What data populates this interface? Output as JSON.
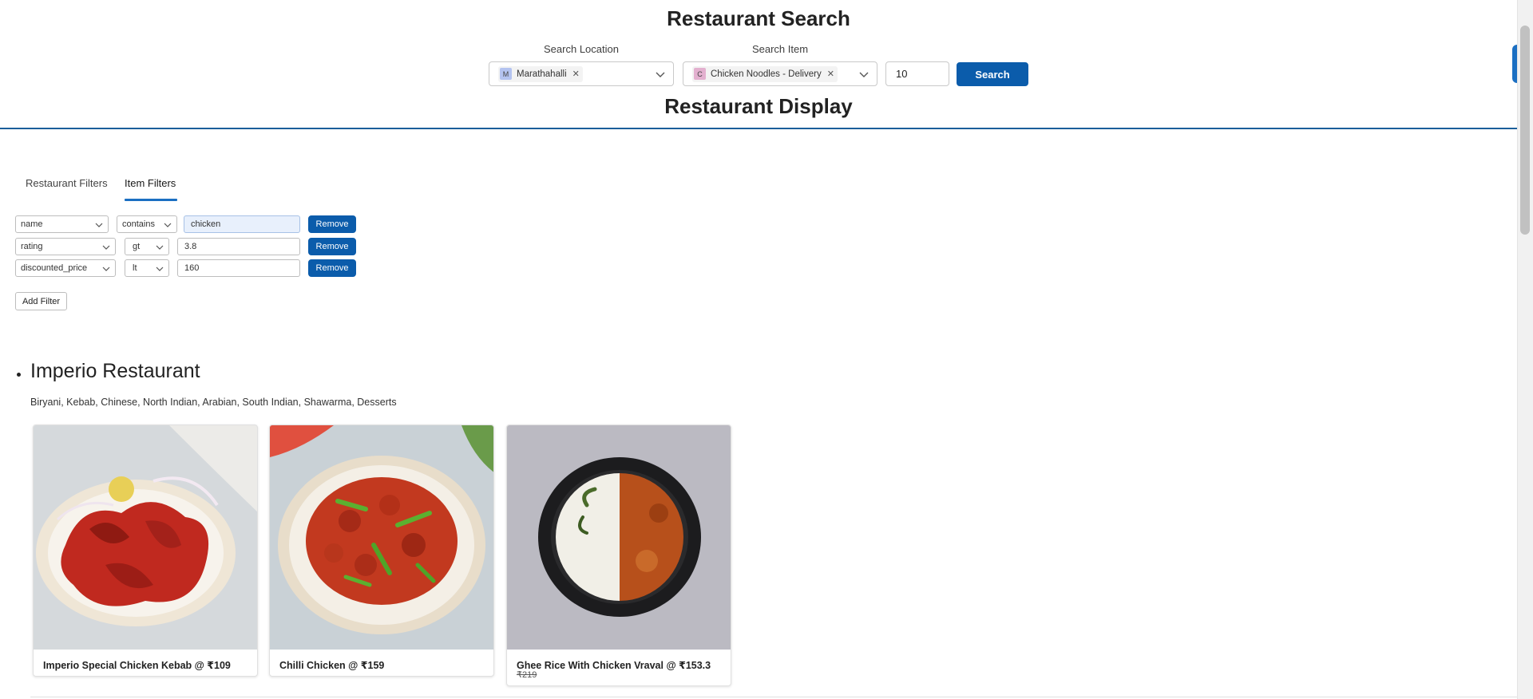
{
  "header": {
    "title": "Restaurant Search",
    "location_label": "Search Location",
    "item_label": "Search Item",
    "location_pill": {
      "avatar": "M",
      "text": "Marathahalli"
    },
    "item_pill": {
      "avatar": "C",
      "text": "Chicken Noodles - Delivery"
    },
    "count_value": "10",
    "search_button": "Search"
  },
  "display": {
    "title": "Restaurant Display"
  },
  "tabs": [
    {
      "label": "Restaurant Filters",
      "active": false
    },
    {
      "label": "Item Filters",
      "active": true
    }
  ],
  "filters": [
    {
      "field": "name",
      "op": "contains",
      "value": "chicken",
      "remove": "Remove"
    },
    {
      "field": "rating",
      "op": "gt",
      "value": "3.8",
      "remove": "Remove"
    },
    {
      "field": "discounted_price",
      "op": "lt",
      "value": "160",
      "remove": "Remove"
    }
  ],
  "add_filter_label": "Add Filter",
  "restaurant": {
    "name": "Imperio Restaurant",
    "cuisines": "Biryani, Kebab, Chinese, North Indian, Arabian, South Indian, Shawarma, Desserts",
    "items": [
      {
        "label": "Imperio Special Chicken Kebab @ ₹109",
        "original_price": ""
      },
      {
        "label": "Chilli Chicken @ ₹159",
        "original_price": ""
      },
      {
        "label": "Ghee Rice With Chicken Vraval @ ₹153.3",
        "original_price": "₹219"
      }
    ]
  },
  "colors": {
    "primary": "#0b5cab",
    "divider": "#1b5e9a",
    "tab_accent": "#1b6fc2"
  }
}
